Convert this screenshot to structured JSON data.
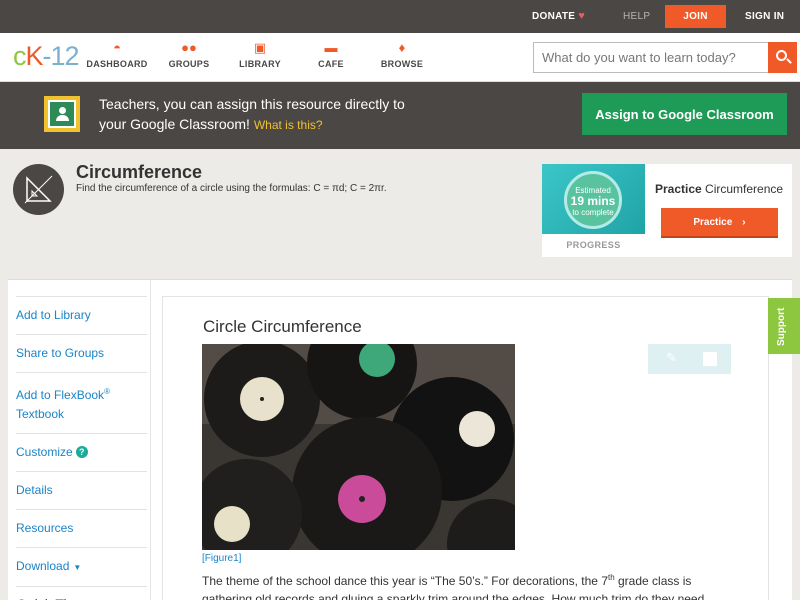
{
  "topbar": {
    "donate": "DONATE",
    "help": "HELP",
    "join": "JOIN",
    "signin": "SIGN IN"
  },
  "nav": {
    "logo_c": "c",
    "logo_k": "K",
    "logo_n": "-12",
    "items": [
      {
        "label": "DASHBOARD",
        "icon": "dashboard-icon"
      },
      {
        "label": "GROUPS",
        "icon": "groups-icon"
      },
      {
        "label": "LIBRARY",
        "icon": "library-icon"
      },
      {
        "label": "CAFE",
        "icon": "cafe-icon"
      },
      {
        "label": "BROWSE",
        "icon": "browse-icon"
      }
    ],
    "search_placeholder": "What do you want to learn today?"
  },
  "banner": {
    "line1": "Teachers, you can assign this resource directly to",
    "line2": "your Google Classroom!",
    "what": "What is this?",
    "assign": "Assign to Google Classroom"
  },
  "header": {
    "title": "Circumference",
    "description": "Find the circumference of a circle using the formulas: C = πd; C = 2πr."
  },
  "practice": {
    "est1": "Estimated",
    "est2": "19 mins",
    "est3": "to complete",
    "progress": "PROGRESS",
    "title_bold": "Practice",
    "title_rest": "Circumference",
    "button": "Practice"
  },
  "sidebar": {
    "add_library": "Add to Library",
    "share": "Share to Groups",
    "flexbook1": "Add to FlexBook",
    "flexbook_reg": "®",
    "flexbook2": "Textbook",
    "customize": "Customize",
    "details": "Details",
    "resources": "Resources",
    "download": "Download",
    "quick_tips": "Quick Tips"
  },
  "content": {
    "title": "Circle Circumference",
    "figure_caption": "[Figure1]",
    "para_a": "The theme of the school dance this year is “The 50’s.” For decorations, the 7",
    "para_sup": "th",
    "para_b": " grade class is gathering old records and gluing a sparkly trim around the edges. How much trim do they need"
  },
  "support": "Support",
  "colors": {
    "accent": "#f05a28",
    "brand_green": "#8dc63f",
    "dark": "#4a4744",
    "classroom_green": "#1e9b56",
    "link": "#1a84c7"
  }
}
